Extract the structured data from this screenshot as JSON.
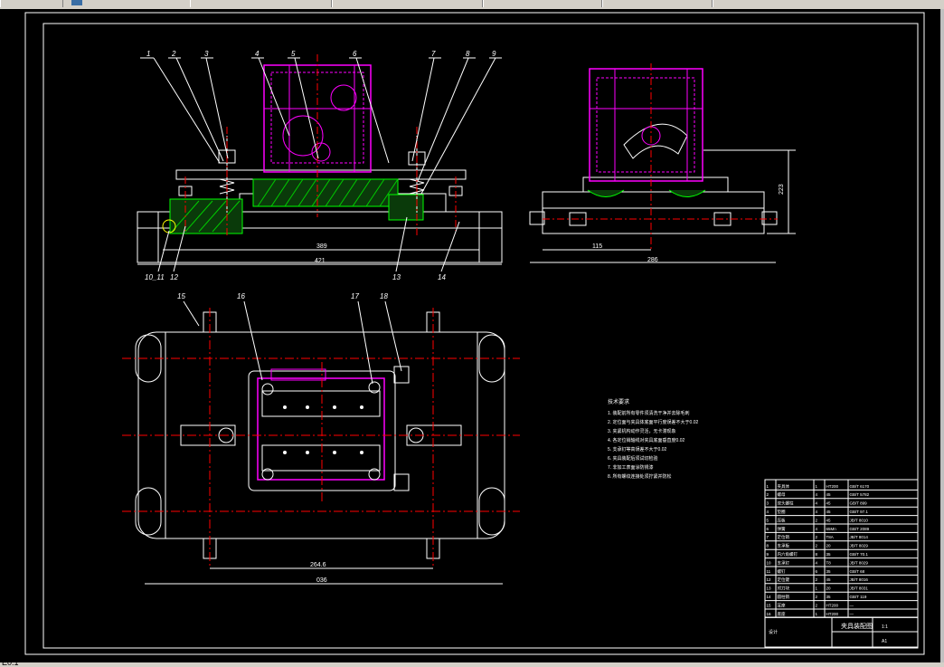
{
  "app": {
    "tabs": [
      {
        "label": ""
      },
      {
        "label": ""
      },
      {
        "label": ""
      },
      {
        "label": ""
      },
      {
        "label": ""
      },
      {
        "label": ""
      }
    ],
    "status_text": "E0.1"
  },
  "drawing": {
    "balloons": [
      "1",
      "2",
      "3",
      "4",
      "5",
      "6",
      "7",
      "8",
      "9",
      "10_11",
      "12",
      "13",
      "14",
      "15",
      "16",
      "17",
      "18"
    ],
    "dims": {
      "front_inner": "389",
      "front_outer": "421",
      "side_height": "223",
      "side_width_a": "115",
      "side_width_b": "286",
      "top_inner": "264.6",
      "top_outer": "036"
    },
    "notes_title": "技术要求",
    "notes": [
      "1. 装配前所有零件须清洗干净并去除毛刺",
      "2. 定位面与夹具体底面平行度误差不大于0.02",
      "3. 夹紧机构动作灵活，无卡滞现象",
      "4. 各定位销轴线对夹具底面垂直度0.02",
      "5. 支承钉等高误差不大于0.02",
      "6. 夹具装配后须试切检验",
      "7. 非加工表面涂防锈漆",
      "8. 所有螺纹连接处须拧紧并防松"
    ],
    "title_block": {
      "name": "夹具装配图",
      "scale": "1:1",
      "sheet": "A1",
      "drawn": "设计",
      "rows": [
        {
          "no": "1",
          "name": "夹具体",
          "qty": "1",
          "mat": "HT200",
          "note": "GB/T 6170"
        },
        {
          "no": "2",
          "name": "螺母",
          "qty": "4",
          "mat": "45",
          "note": "GB/T 5782"
        },
        {
          "no": "3",
          "name": "双头螺柱",
          "qty": "4",
          "mat": "45",
          "note": "GB/T 899"
        },
        {
          "no": "4",
          "name": "垫圈",
          "qty": "4",
          "mat": "45",
          "note": "GB/T 97.1"
        },
        {
          "no": "5",
          "name": "压板",
          "qty": "2",
          "mat": "45",
          "note": "JB/T 8010"
        },
        {
          "no": "6",
          "name": "弹簧",
          "qty": "4",
          "mat": "65Mn",
          "note": "GB/T 2089"
        },
        {
          "no": "7",
          "name": "定位销",
          "qty": "2",
          "mat": "T8A",
          "note": "JB/T 8014"
        },
        {
          "no": "8",
          "name": "支承板",
          "qty": "2",
          "mat": "20",
          "note": "JB/T 8029"
        },
        {
          "no": "9",
          "name": "内六角螺钉",
          "qty": "8",
          "mat": "35",
          "note": "GB/T 70.1"
        },
        {
          "no": "10",
          "name": "支承钉",
          "qty": "4",
          "mat": "T8",
          "note": "JB/T 8029"
        },
        {
          "no": "11",
          "name": "螺钉",
          "qty": "6",
          "mat": "35",
          "note": "GB/T 68"
        },
        {
          "no": "12",
          "name": "定位键",
          "qty": "2",
          "mat": "45",
          "note": "JB/T 8016"
        },
        {
          "no": "13",
          "name": "对刀块",
          "qty": "1",
          "mat": "20",
          "note": "JB/T 8031"
        },
        {
          "no": "14",
          "name": "圆柱销",
          "qty": "2",
          "mat": "35",
          "note": "GB/T 119"
        },
        {
          "no": "15",
          "name": "耳座",
          "qty": "2",
          "mat": "HT200",
          "note": "—"
        },
        {
          "no": "16",
          "name": "底座",
          "qty": "1",
          "mat": "HT200",
          "note": "—"
        }
      ]
    }
  }
}
